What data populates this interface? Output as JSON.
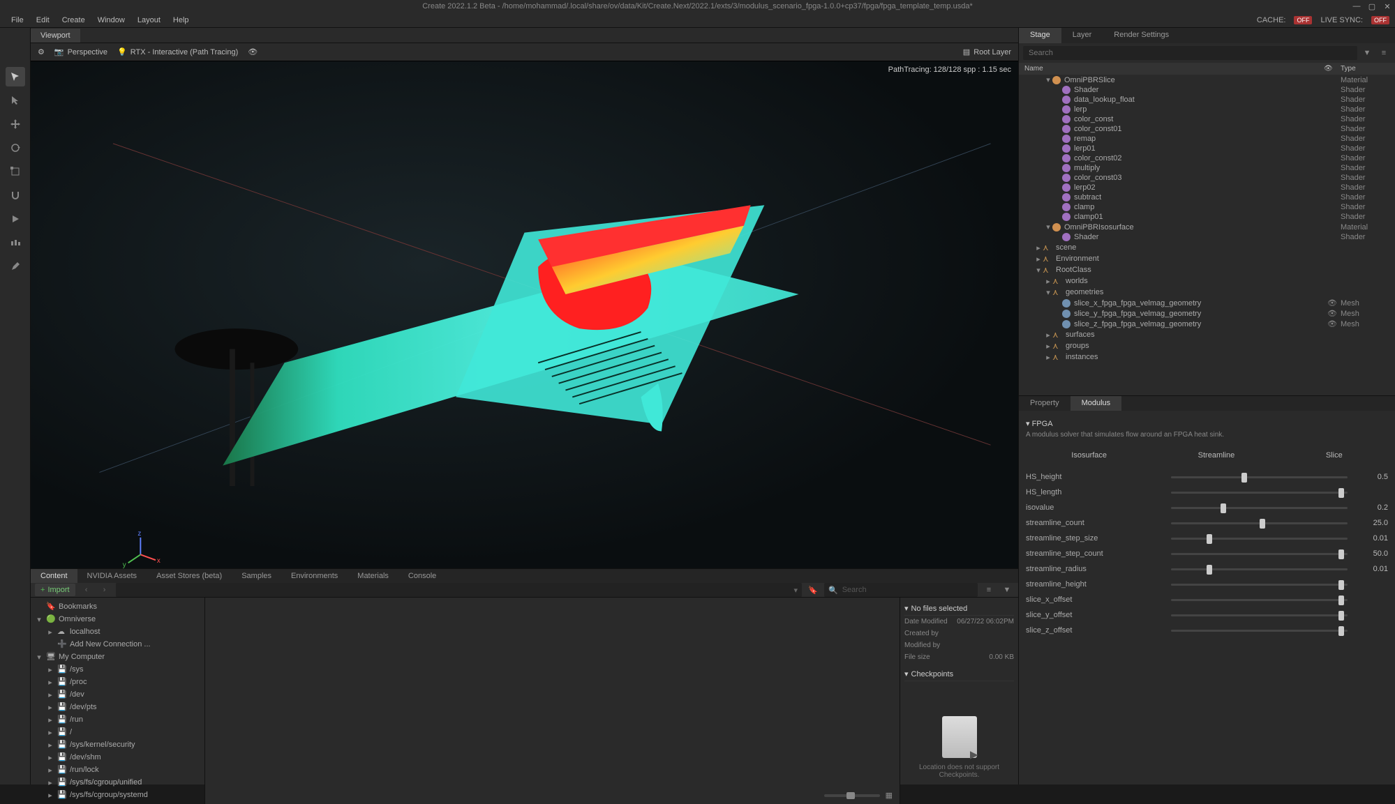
{
  "titlebar": {
    "title": "Create 2022.1.2 Beta - /home/mohammad/.local/share/ov/data/Kit/Create.Next/2022.1/exts/3/modulus_scenario_fpga-1.0.0+cp37/fpga/fpga_template_temp.usda*"
  },
  "menubar": {
    "items": [
      "File",
      "Edit",
      "Create",
      "Window",
      "Layout",
      "Help"
    ],
    "cache_label": "CACHE:",
    "cache_status": "OFF",
    "livesync_label": "LIVE SYNC:",
    "livesync_status": "OFF"
  },
  "viewport": {
    "tab": "Viewport",
    "perspective": "Perspective",
    "renderer": "RTX - Interactive (Path Tracing)",
    "root_layer": "Root Layer",
    "render_info": "PathTracing: 128/128 spp : 1.15 sec"
  },
  "bottom": {
    "tabs": [
      "Content",
      "NVIDIA Assets",
      "Asset Stores (beta)",
      "Samples",
      "Environments",
      "Materials",
      "Console"
    ],
    "active_tab": 0,
    "import": "Import",
    "search_placeholder": "Search",
    "tree": [
      {
        "label": "Bookmarks",
        "icon": "bookmark",
        "indent": 0,
        "exp": ""
      },
      {
        "label": "Omniverse",
        "icon": "ov",
        "indent": 0,
        "exp": "▾"
      },
      {
        "label": "localhost",
        "icon": "cloud",
        "indent": 1,
        "exp": "▸"
      },
      {
        "label": "Add New Connection ...",
        "icon": "plus",
        "indent": 1,
        "exp": ""
      },
      {
        "label": "My Computer",
        "icon": "pc",
        "indent": 0,
        "exp": "▾"
      },
      {
        "label": "/sys",
        "icon": "drive",
        "indent": 1,
        "exp": "▸"
      },
      {
        "label": "/proc",
        "icon": "drive",
        "indent": 1,
        "exp": "▸"
      },
      {
        "label": "/dev",
        "icon": "drive",
        "indent": 1,
        "exp": "▸"
      },
      {
        "label": "/dev/pts",
        "icon": "drive",
        "indent": 1,
        "exp": "▸"
      },
      {
        "label": "/run",
        "icon": "drive",
        "indent": 1,
        "exp": "▸"
      },
      {
        "label": "/",
        "icon": "drive",
        "indent": 1,
        "exp": "▸"
      },
      {
        "label": "/sys/kernel/security",
        "icon": "drive",
        "indent": 1,
        "exp": "▸"
      },
      {
        "label": "/dev/shm",
        "icon": "drive",
        "indent": 1,
        "exp": "▸"
      },
      {
        "label": "/run/lock",
        "icon": "drive",
        "indent": 1,
        "exp": "▸"
      },
      {
        "label": "/sys/fs/cgroup/unified",
        "icon": "drive",
        "indent": 1,
        "exp": "▸"
      },
      {
        "label": "/sys/fs/cgroup/systemd",
        "icon": "drive",
        "indent": 1,
        "exp": "▸"
      }
    ],
    "details": {
      "no_files": "No files selected",
      "rows": [
        {
          "k": "Date Modified",
          "v": "06/27/22 06:02PM"
        },
        {
          "k": "Created by",
          "v": ""
        },
        {
          "k": "Modified by",
          "v": ""
        },
        {
          "k": "File size",
          "v": "0.00 KB"
        }
      ],
      "checkpoints": "Checkpoints",
      "checkpoint_msg": "Location does not support Checkpoints."
    }
  },
  "stage": {
    "tabs": [
      "Stage",
      "Layer",
      "Render Settings"
    ],
    "active_tab": 0,
    "search_placeholder": "Search",
    "col_name": "Name",
    "col_type": "Type",
    "rows": [
      {
        "indent": 2,
        "exp": "▾",
        "icon": "orange",
        "label": "OmniPBRSlice",
        "type": "Material",
        "vis": ""
      },
      {
        "indent": 3,
        "exp": "",
        "icon": "purple",
        "label": "Shader",
        "type": "Shader",
        "vis": ""
      },
      {
        "indent": 3,
        "exp": "",
        "icon": "purple",
        "label": "data_lookup_float",
        "type": "Shader",
        "vis": ""
      },
      {
        "indent": 3,
        "exp": "",
        "icon": "purple",
        "label": "lerp",
        "type": "Shader",
        "vis": ""
      },
      {
        "indent": 3,
        "exp": "",
        "icon": "purple",
        "label": "color_const",
        "type": "Shader",
        "vis": ""
      },
      {
        "indent": 3,
        "exp": "",
        "icon": "purple",
        "label": "color_const01",
        "type": "Shader",
        "vis": ""
      },
      {
        "indent": 3,
        "exp": "",
        "icon": "purple",
        "label": "remap",
        "type": "Shader",
        "vis": ""
      },
      {
        "indent": 3,
        "exp": "",
        "icon": "purple",
        "label": "lerp01",
        "type": "Shader",
        "vis": ""
      },
      {
        "indent": 3,
        "exp": "",
        "icon": "purple",
        "label": "color_const02",
        "type": "Shader",
        "vis": ""
      },
      {
        "indent": 3,
        "exp": "",
        "icon": "purple",
        "label": "multiply",
        "type": "Shader",
        "vis": ""
      },
      {
        "indent": 3,
        "exp": "",
        "icon": "purple",
        "label": "color_const03",
        "type": "Shader",
        "vis": ""
      },
      {
        "indent": 3,
        "exp": "",
        "icon": "purple",
        "label": "lerp02",
        "type": "Shader",
        "vis": ""
      },
      {
        "indent": 3,
        "exp": "",
        "icon": "purple",
        "label": "subtract",
        "type": "Shader",
        "vis": ""
      },
      {
        "indent": 3,
        "exp": "",
        "icon": "purple",
        "label": "clamp",
        "type": "Shader",
        "vis": ""
      },
      {
        "indent": 3,
        "exp": "",
        "icon": "purple",
        "label": "clamp01",
        "type": "Shader",
        "vis": ""
      },
      {
        "indent": 2,
        "exp": "▾",
        "icon": "orange",
        "label": "OmniPBRIsosurface",
        "type": "Material",
        "vis": ""
      },
      {
        "indent": 3,
        "exp": "",
        "icon": "purple",
        "label": "Shader",
        "type": "Shader",
        "vis": ""
      },
      {
        "indent": 1,
        "exp": "▸",
        "icon": "xform",
        "label": "scene",
        "type": "",
        "vis": ""
      },
      {
        "indent": 1,
        "exp": "▸",
        "icon": "xform",
        "label": "Environment",
        "type": "",
        "vis": ""
      },
      {
        "indent": 1,
        "exp": "▾",
        "icon": "xform",
        "label": "RootClass",
        "type": "",
        "vis": ""
      },
      {
        "indent": 2,
        "exp": "▸",
        "icon": "xform",
        "label": "worlds",
        "type": "",
        "vis": ""
      },
      {
        "indent": 2,
        "exp": "▾",
        "icon": "xform",
        "label": "geometries",
        "type": "",
        "vis": ""
      },
      {
        "indent": 3,
        "exp": "",
        "icon": "mesh",
        "label": "slice_x_fpga_fpga_velmag_geometry",
        "type": "Mesh",
        "vis": "👁"
      },
      {
        "indent": 3,
        "exp": "",
        "icon": "mesh",
        "label": "slice_y_fpga_fpga_velmag_geometry",
        "type": "Mesh",
        "vis": "👁"
      },
      {
        "indent": 3,
        "exp": "",
        "icon": "mesh",
        "label": "slice_z_fpga_fpga_velmag_geometry",
        "type": "Mesh",
        "vis": "👁"
      },
      {
        "indent": 2,
        "exp": "▸",
        "icon": "xform",
        "label": "surfaces",
        "type": "",
        "vis": ""
      },
      {
        "indent": 2,
        "exp": "▸",
        "icon": "xform",
        "label": "groups",
        "type": "",
        "vis": ""
      },
      {
        "indent": 2,
        "exp": "▸",
        "icon": "xform",
        "label": "instances",
        "type": "",
        "vis": ""
      }
    ]
  },
  "property": {
    "tabs": [
      "Property",
      "Modulus"
    ],
    "active_tab": 1,
    "section": "FPGA",
    "desc": "A modulus solver that simulates flow around an FPGA heat sink.",
    "modes": [
      "Isosurface",
      "Streamline",
      "Slice"
    ],
    "params": [
      {
        "label": "HS_height",
        "value": "0.5",
        "pos": 40
      },
      {
        "label": "HS_length",
        "value": "",
        "pos": 95
      },
      {
        "label": "isovalue",
        "value": "0.2",
        "pos": 28
      },
      {
        "label": "streamline_count",
        "value": "25.0",
        "pos": 50
      },
      {
        "label": "streamline_step_size",
        "value": "0.01",
        "pos": 20
      },
      {
        "label": "streamline_step_count",
        "value": "50.0",
        "pos": 95
      },
      {
        "label": "streamline_radius",
        "value": "0.01",
        "pos": 20
      },
      {
        "label": "streamline_height",
        "value": "",
        "pos": 95
      },
      {
        "label": "slice_x_offset",
        "value": "",
        "pos": 95
      },
      {
        "label": "slice_y_offset",
        "value": "",
        "pos": 95
      },
      {
        "label": "slice_z_offset",
        "value": "",
        "pos": 95
      }
    ]
  }
}
